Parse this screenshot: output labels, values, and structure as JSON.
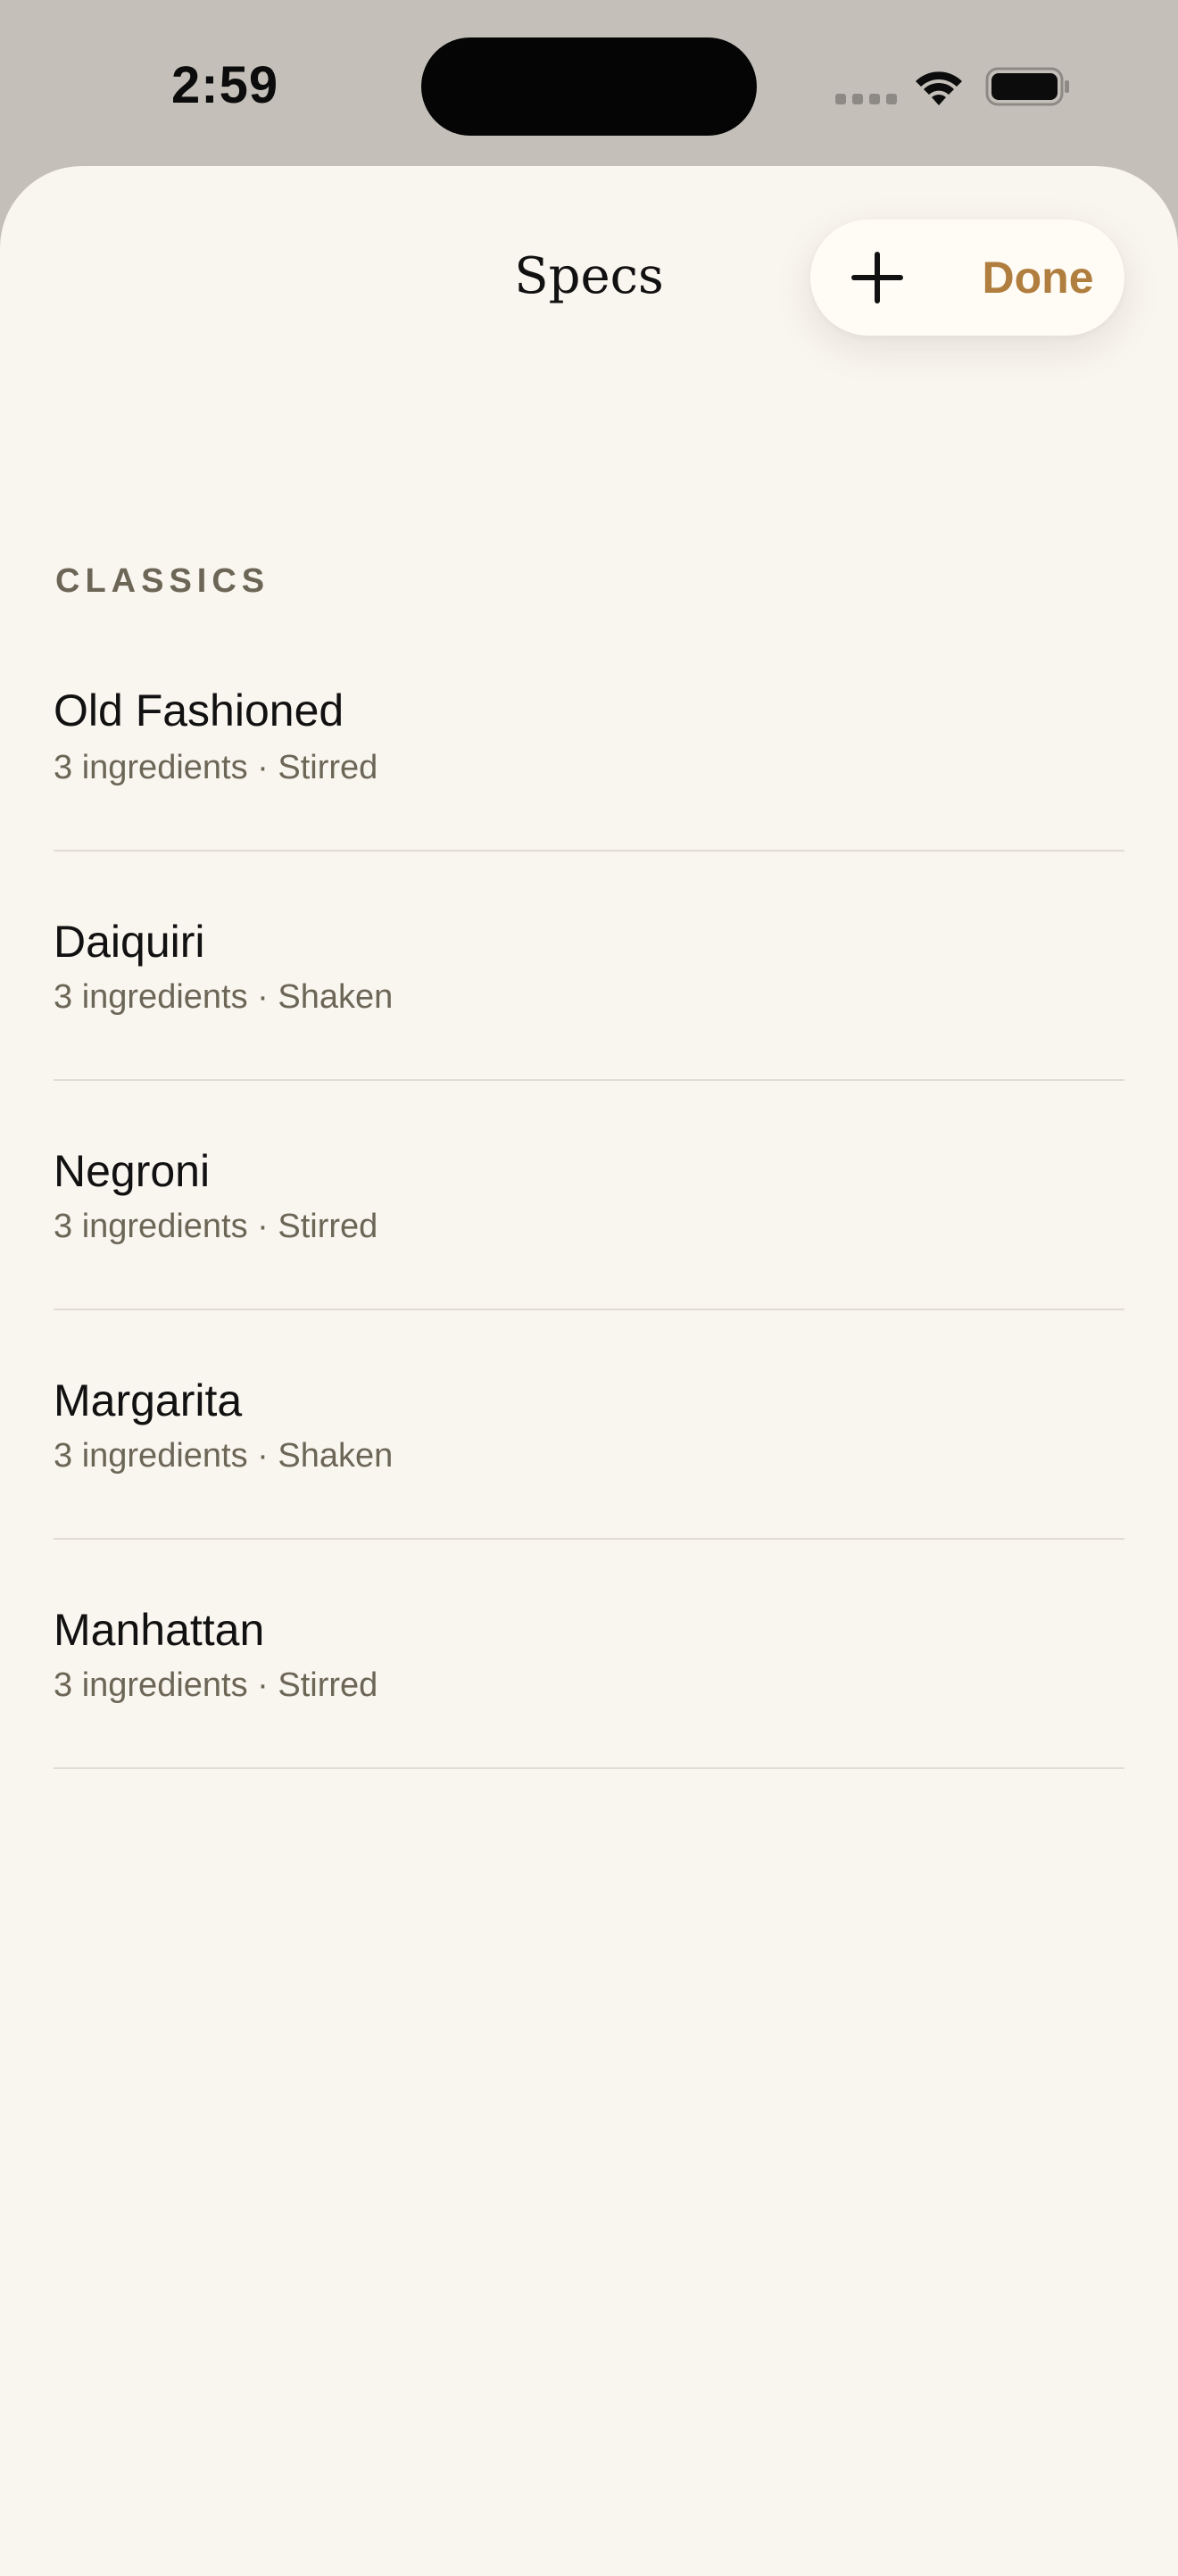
{
  "status_bar": {
    "time": "2:59"
  },
  "header": {
    "title": "Specs",
    "add_icon": "plus-icon",
    "done_label": "Done"
  },
  "section": {
    "title": "CLASSICS"
  },
  "cocktails": [
    {
      "name": "Old Fashioned",
      "details": "3 ingredients · Stirred"
    },
    {
      "name": "Daiquiri",
      "details": "3 ingredients · Shaken"
    },
    {
      "name": "Negroni",
      "details": "3 ingredients · Stirred"
    },
    {
      "name": "Margarita",
      "details": "3 ingredients · Shaken"
    },
    {
      "name": "Manhattan",
      "details": "3 ingredients · Stirred"
    }
  ],
  "colors": {
    "accent": "#b07e3e",
    "background": "#f9f5ef",
    "secondary_text": "#6c6657"
  }
}
